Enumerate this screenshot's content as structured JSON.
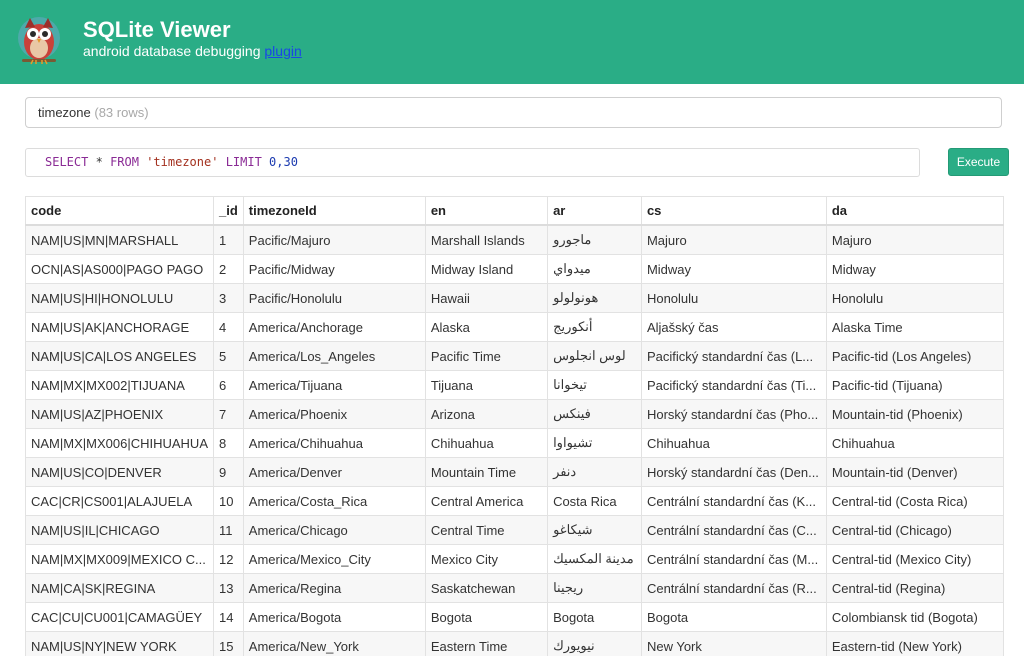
{
  "header": {
    "title": "SQLite Viewer",
    "subtitle": "android database debugging",
    "link_label": "plugin",
    "color": "#2aad86"
  },
  "table_select": {
    "name": "timezone",
    "rows_label": "(83 rows)"
  },
  "query": {
    "select": "SELECT",
    "star": "*",
    "from": "FROM",
    "table": "'timezone'",
    "limit": "LIMIT",
    "range": "0,30"
  },
  "execute_label": "Execute",
  "grid": {
    "columns": [
      "code",
      "_id",
      "timezoneId",
      "en",
      "ar",
      "cs",
      "da"
    ],
    "rows": [
      [
        "NAM|US|MN|MARSHALL",
        "1",
        "Pacific/Majuro",
        "Marshall Islands",
        "ماجورو",
        "Majuro",
        "Majuro"
      ],
      [
        "OCN|AS|AS000|PAGO PAGO",
        "2",
        "Pacific/Midway",
        "Midway Island",
        "ميدواي",
        "Midway",
        "Midway"
      ],
      [
        "NAM|US|HI|HONOLULU",
        "3",
        "Pacific/Honolulu",
        "Hawaii",
        "هونولولو",
        "Honolulu",
        "Honolulu"
      ],
      [
        "NAM|US|AK|ANCHORAGE",
        "4",
        "America/Anchorage",
        "Alaska",
        "أنكوريج",
        "Aljašský čas",
        "Alaska Time"
      ],
      [
        "NAM|US|CA|LOS ANGELES",
        "5",
        "America/Los_Angeles",
        "Pacific Time",
        "لوس انجلوس",
        "Pacifický standardní čas (L...",
        "Pacific-tid (Los Angeles)"
      ],
      [
        "NAM|MX|MX002|TIJUANA",
        "6",
        "America/Tijuana",
        "Tijuana",
        "تيخوانا",
        "Pacifický standardní čas (Ti...",
        "Pacific-tid (Tijuana)"
      ],
      [
        "NAM|US|AZ|PHOENIX",
        "7",
        "America/Phoenix",
        "Arizona",
        "فينكس",
        "Horský standardní čas (Pho...",
        "Mountain-tid (Phoenix)"
      ],
      [
        "NAM|MX|MX006|CHIHUAHUA",
        "8",
        "America/Chihuahua",
        "Chihuahua",
        "تشيواوا",
        "Chihuahua",
        "Chihuahua"
      ],
      [
        "NAM|US|CO|DENVER",
        "9",
        "America/Denver",
        "Mountain Time",
        "دنفر",
        "Horský standardní čas (Den...",
        "Mountain-tid (Denver)"
      ],
      [
        "CAC|CR|CS001|ALAJUELA",
        "10",
        "America/Costa_Rica",
        "Central America",
        "Costa Rica",
        "Centrální standardní čas (K...",
        "Central-tid (Costa Rica)"
      ],
      [
        "NAM|US|IL|CHICAGO",
        "11",
        "America/Chicago",
        "Central Time",
        "شيكاغو",
        "Centrální standardní čas (C...",
        "Central-tid (Chicago)"
      ],
      [
        "NAM|MX|MX009|MEXICO C...",
        "12",
        "America/Mexico_City",
        "Mexico City",
        "مدينة المكسيك",
        "Centrální standardní čas (M...",
        "Central-tid (Mexico City)"
      ],
      [
        "NAM|CA|SK|REGINA",
        "13",
        "America/Regina",
        "Saskatchewan",
        "ريجينا",
        "Centrální standardní čas (R...",
        "Central-tid (Regina)"
      ],
      [
        "CAC|CU|CU001|CAMAGÜEY",
        "14",
        "America/Bogota",
        "Bogota",
        "Bogota",
        "Bogota",
        "Colombiansk tid (Bogota)"
      ],
      [
        "NAM|US|NY|NEW YORK",
        "15",
        "America/New_York",
        "Eastern Time",
        "نيويورك",
        "New York",
        "Eastern-tid (New York)"
      ]
    ]
  }
}
